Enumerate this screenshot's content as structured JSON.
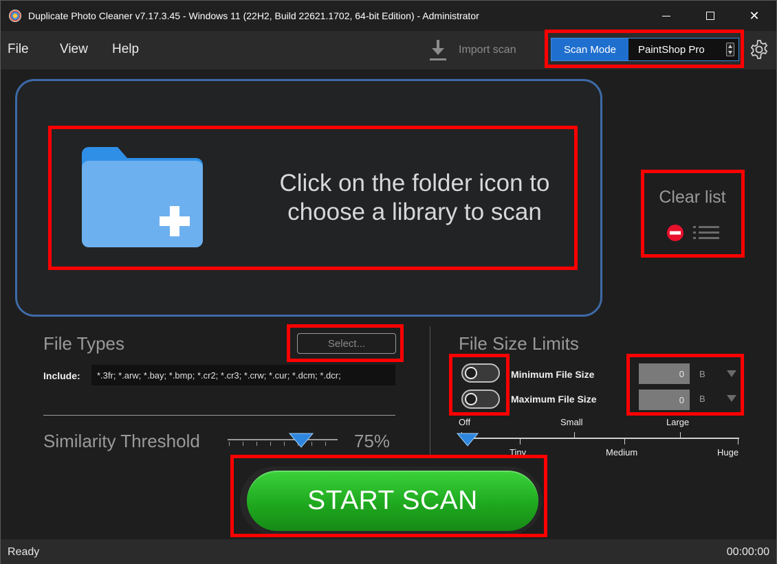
{
  "window": {
    "title": "Duplicate Photo Cleaner v7.17.3.45 - Windows 11 (22H2, Build 22621.1702, 64-bit Edition) - Administrator",
    "controls": {
      "minimize": "—",
      "maximize": "☐",
      "close": "✕"
    }
  },
  "menu": {
    "file": "File",
    "view": "View",
    "help": "Help"
  },
  "toolbar": {
    "import_label": "Import scan",
    "scan_mode_label": "Scan Mode",
    "scan_mode_value": "PaintShop Pro"
  },
  "dropzone": {
    "text": "Click on the folder icon to choose a library to scan",
    "clear_list": "Clear list"
  },
  "file_types": {
    "title": "File Types",
    "select_button": "Select...",
    "include_label": "Include:",
    "include_value": "*.3fr; *.arw; *.bay; *.bmp; *.cr2; *.cr3; *.crw; *.cur; *.dcm; *.dcr;"
  },
  "similarity": {
    "title": "Similarity Threshold",
    "value_label": "75%",
    "value": 0.75
  },
  "file_size": {
    "title": "File Size Limits",
    "min_label": "Minimum File Size",
    "max_label": "Maximum File Size",
    "min_value": "0",
    "max_value": "0",
    "min_unit": "B",
    "max_unit": "B",
    "min_enabled": false,
    "max_enabled": false,
    "scale_top": [
      "Off",
      "Small",
      "Large"
    ],
    "scale_bottom": [
      "Tiny",
      "Medium",
      "Huge"
    ]
  },
  "start_button": "START SCAN",
  "status": {
    "left": "Ready",
    "right": "00:00:00"
  },
  "colors": {
    "accent_blue": "#1f6fcf",
    "start_green": "#1fa91f",
    "highlight_red": "#ff0000",
    "background": "#1e1e1e"
  }
}
